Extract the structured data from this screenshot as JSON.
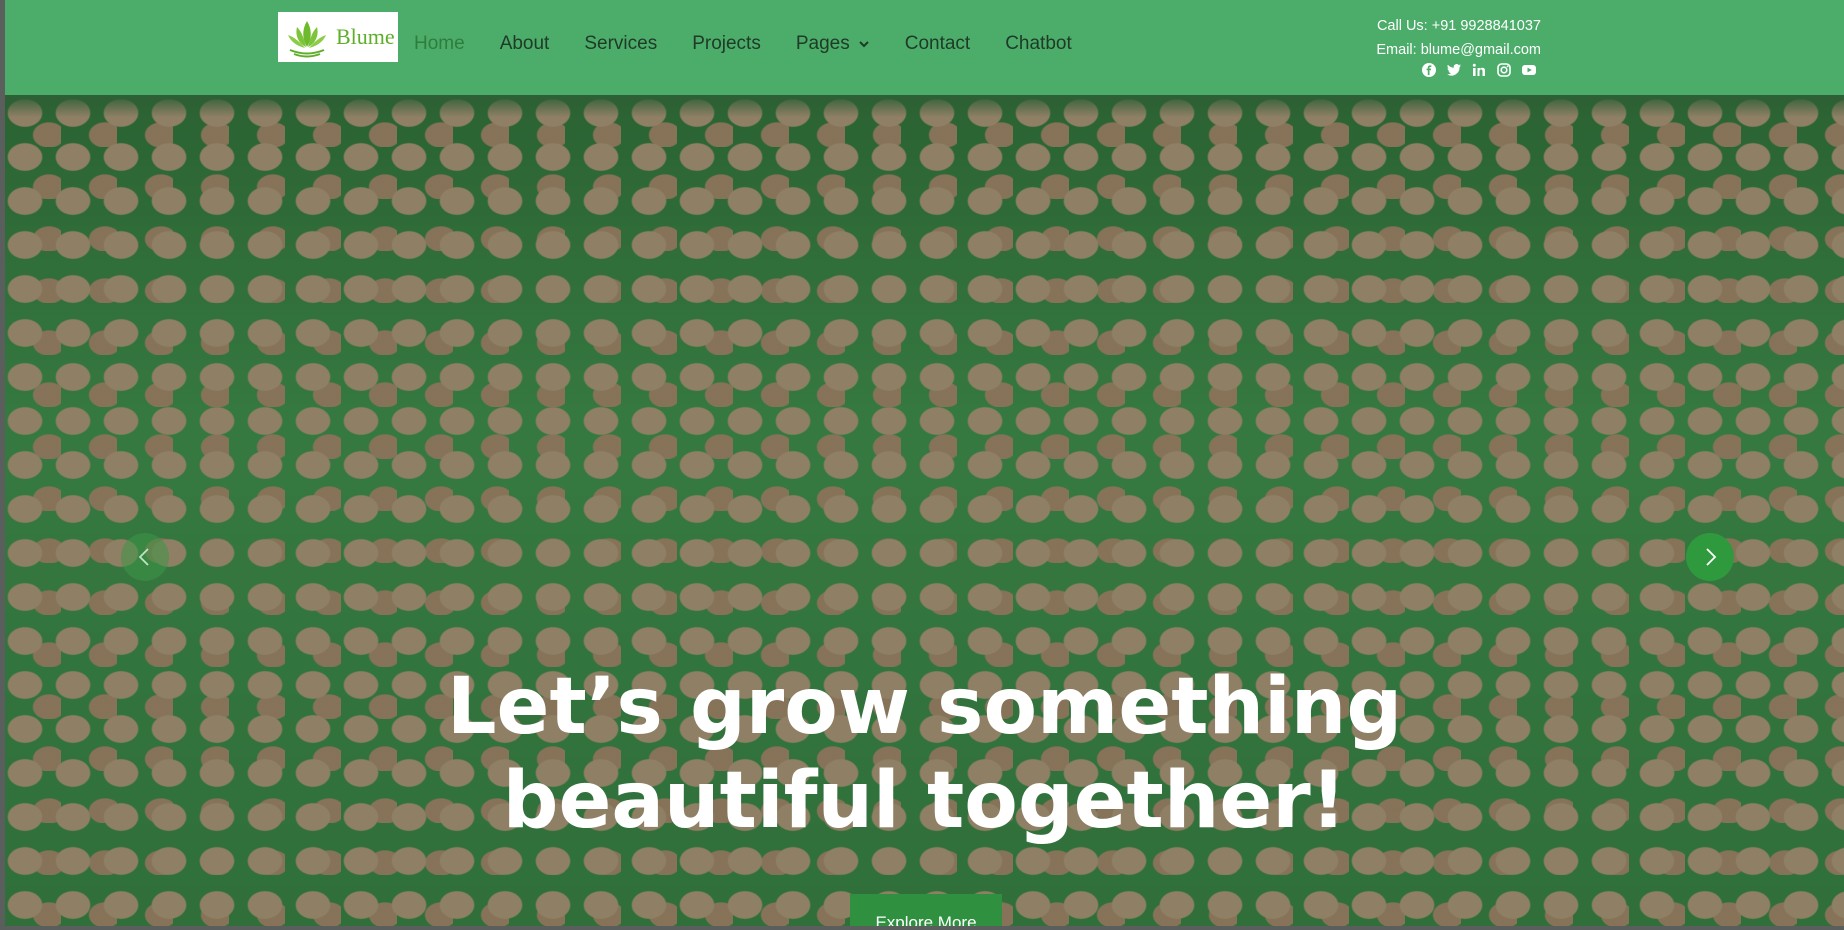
{
  "brand": {
    "name": "Blume"
  },
  "nav": {
    "items": [
      {
        "label": "Home",
        "active": true
      },
      {
        "label": "About"
      },
      {
        "label": "Services"
      },
      {
        "label": "Projects"
      },
      {
        "label": "Pages",
        "has_dropdown": true
      },
      {
        "label": "Contact"
      },
      {
        "label": "Chatbot"
      }
    ]
  },
  "contact": {
    "phone": "Call Us: +91 9928841037",
    "email": "Email: blume@gmail.com"
  },
  "socials": [
    "facebook-icon",
    "twitter-icon",
    "linkedin-icon",
    "instagram-icon",
    "youtube-icon"
  ],
  "hero": {
    "headline_line1": "Let’s grow something",
    "headline_line2": "beautiful together!",
    "cta_label": "Explore More"
  },
  "colors": {
    "header_bg": "#4cad6b",
    "nav_text": "#1f3a26",
    "nav_active": "#2f7d3c",
    "cta_bg": "#2f9140",
    "logo_green": "#5fae2a"
  }
}
